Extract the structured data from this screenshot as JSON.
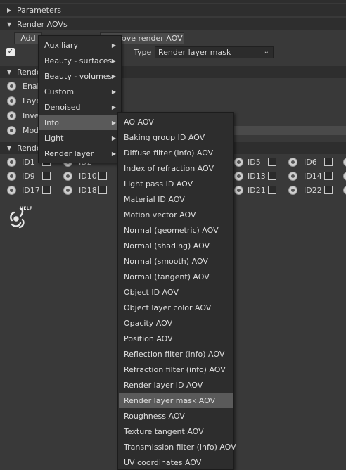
{
  "sections": {
    "parameters": "Parameters",
    "render_aovs": "Render AOVs",
    "render_section_2": "Render",
    "render_section_3": "Render"
  },
  "aov_panel": {
    "add_label": "Add",
    "remove_label": "ove render AOV",
    "type_label": "Type",
    "type_value": "Render layer mask"
  },
  "options": {
    "opt1": "Enab",
    "opt2": "Laye",
    "opt3": "Inve",
    "opt4": "Mod"
  },
  "id_grid": {
    "row1": [
      "ID1",
      "ID2",
      "ID5",
      "ID6"
    ],
    "row2": [
      "ID9",
      "ID10",
      "ID13",
      "ID14"
    ],
    "row3": [
      "ID17",
      "ID18",
      "ID21",
      "ID22"
    ]
  },
  "help": {
    "label": "HELP"
  },
  "menu_main": {
    "items": [
      {
        "label": "Auxiliary",
        "has_submenu": true
      },
      {
        "label": "Beauty - surfaces",
        "has_submenu": true
      },
      {
        "label": "Beauty - volumes",
        "has_submenu": true
      },
      {
        "label": "Custom",
        "has_submenu": true
      },
      {
        "label": "Denoised",
        "has_submenu": true
      },
      {
        "label": "Info",
        "has_submenu": true,
        "highlighted": true
      },
      {
        "label": "Light",
        "has_submenu": true
      },
      {
        "label": "Render layer",
        "has_submenu": true
      }
    ]
  },
  "menu_info": {
    "items": [
      "AO AOV",
      "Baking group ID AOV",
      "Diffuse filter (info) AOV",
      "Index of refraction AOV",
      "Light pass ID AOV",
      "Material ID AOV",
      "Motion vector AOV",
      "Normal (geometric) AOV",
      "Normal (shading) AOV",
      "Normal (smooth) AOV",
      "Normal (tangent) AOV",
      "Object ID AOV",
      "Object layer color AOV",
      "Opacity AOV",
      "Position AOV",
      "Reflection filter (info) AOV",
      "Refraction filter (info) AOV",
      "Render layer ID AOV",
      "Render layer mask AOV",
      "Roughness AOV",
      "Texture tangent AOV",
      "Transmission filter (info) AOV",
      "UV coordinates AOV"
    ],
    "highlighted": "Render layer mask AOV"
  }
}
